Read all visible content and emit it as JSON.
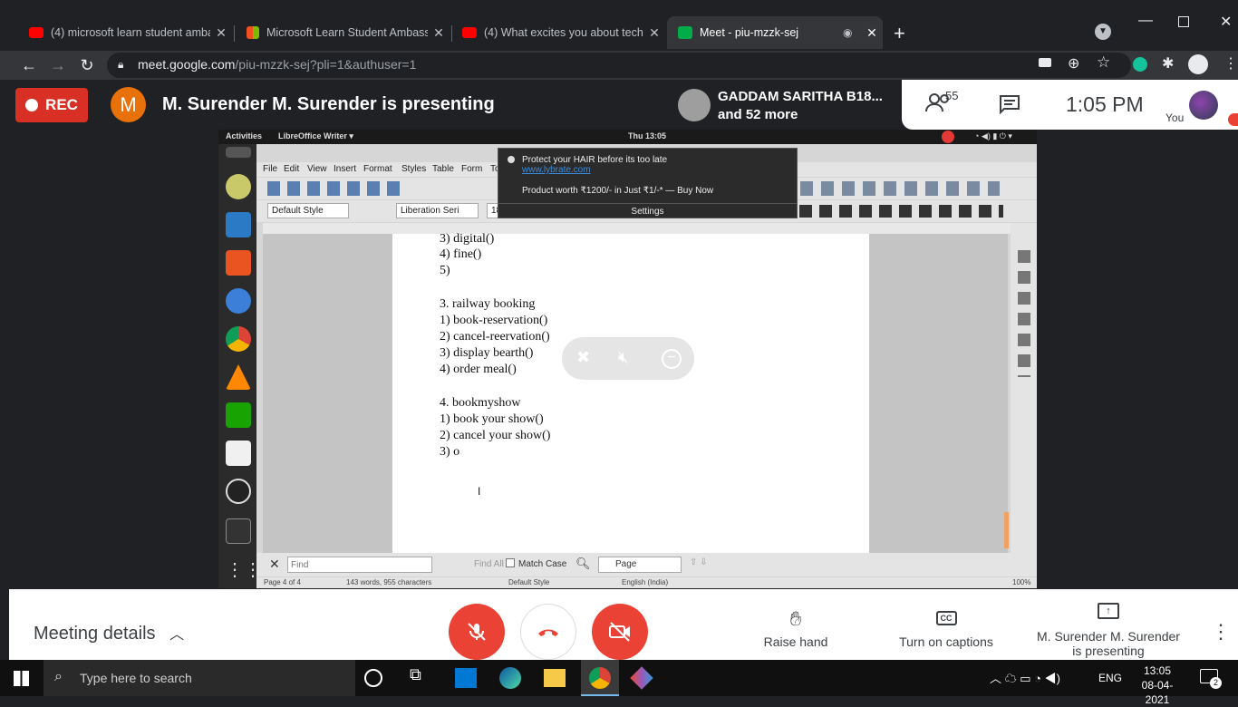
{
  "browser": {
    "tabs": [
      {
        "label": "(4) microsoft learn student amba",
        "icon": "youtube-icon",
        "active": false
      },
      {
        "label": "Microsoft Learn Student Ambass",
        "icon": "microsoft-icon",
        "active": false
      },
      {
        "label": "(4) What excites you about techn",
        "icon": "youtube-icon",
        "active": false
      },
      {
        "label": "Meet - piu-mzzk-sej",
        "icon": "meet-icon",
        "active": true
      }
    ],
    "url_host": "meet.google.com",
    "url_path": "/piu-mzzk-sej?pli=1&authuser=1"
  },
  "meet": {
    "rec_label": "REC",
    "presenter_initial": "M",
    "presenting_text": "M. Surender M. Surender is presenting",
    "participant_name": "GADDAM SARITHA B18...",
    "participant_more": "and 52 more",
    "participant_count": "55",
    "clock": "1:05 PM",
    "you_label": "You",
    "meeting_details": "Meeting details",
    "raise_hand": "Raise hand",
    "captions": "Turn on captions",
    "presenting_footer_1": "M. Surender M. Surender",
    "presenting_footer_2": "is presenting"
  },
  "shared": {
    "activities": "Activities",
    "app_name": "LibreOffice Writer ▾",
    "gnome_clock": "Thu 13:05",
    "menu": [
      "File",
      "Edit",
      "View",
      "Insert",
      "Format",
      "Styles",
      "Table",
      "Form",
      "To"
    ],
    "para_style": "Default Style",
    "font_name": "Liberation Seri",
    "font_size": "18",
    "doc_lines": [
      "3) digital()",
      "4) fine()",
      "5)",
      "",
      "3. railway booking",
      "1) book-reservation()",
      "2) cancel-reervation()",
      "3) display bearth()",
      "4) order meal()",
      "",
      "4. bookmyshow",
      "1) book your show()",
      "2) cancel your show()",
      "3) o"
    ],
    "popup_title": "Protect your HAIR before its too late",
    "popup_link": "www.lybrate.com",
    "popup_body": "Product worth ₹1200/- in Just ₹1/-* — Buy Now",
    "popup_settings": "Settings",
    "find_placeholder": "Find",
    "find_all": "Find All",
    "match_case": "Match Case",
    "search_scope": "Page",
    "status_page": "Page 4 of 4",
    "status_words": "143 words, 955 characters",
    "status_style": "Default Style",
    "status_lang": "English (India)",
    "status_zoom": "100%"
  },
  "taskbar": {
    "search_placeholder": "Type here to search",
    "lang": "ENG",
    "time": "13:05",
    "date": "08-04-2021",
    "notif_count": "2"
  },
  "colors": {
    "rec_red": "#d93025",
    "meet_red": "#ea4335",
    "avatar_orange": "#e8710a",
    "chrome_dark": "#202124"
  }
}
